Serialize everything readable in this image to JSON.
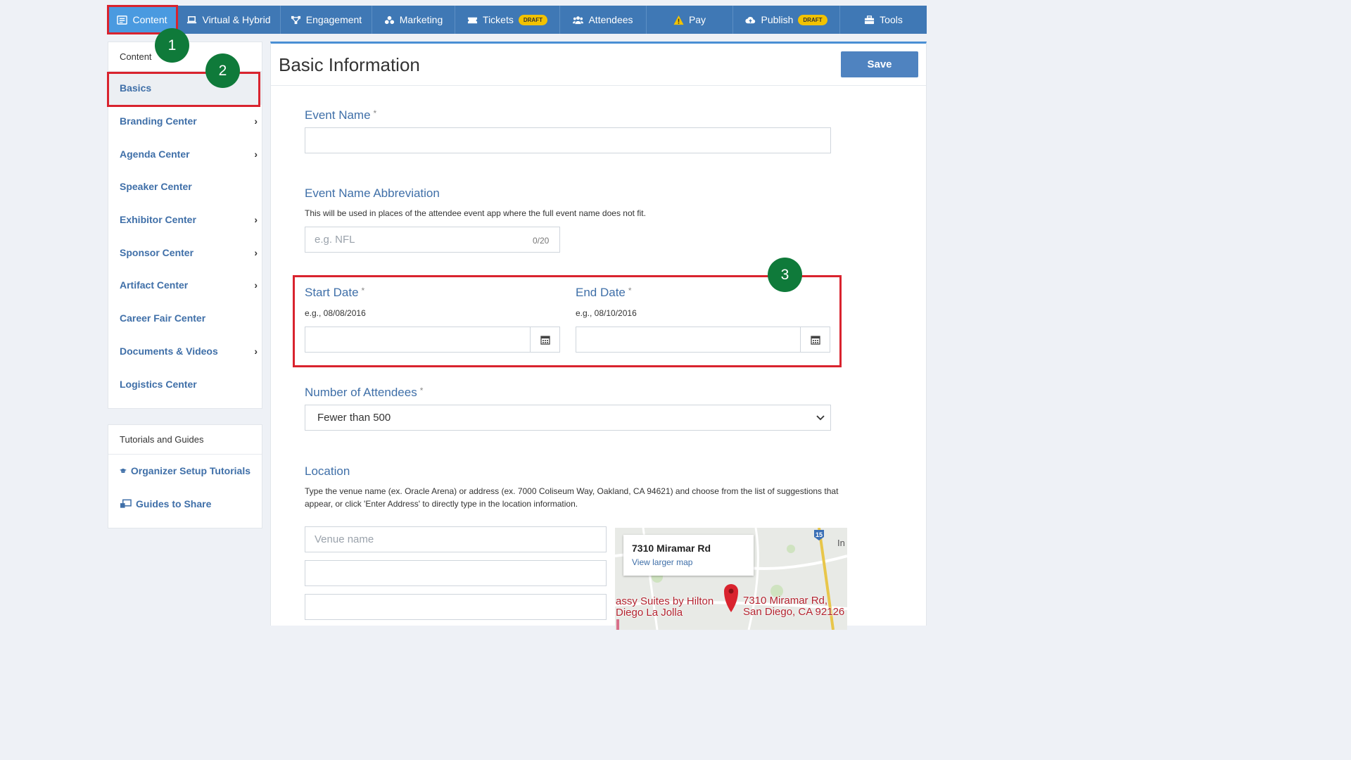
{
  "topnav": {
    "items": [
      {
        "label": "Content",
        "icon": "content-icon"
      },
      {
        "label": "Virtual & Hybrid",
        "icon": "laptop-icon"
      },
      {
        "label": "Engagement",
        "icon": "engagement-icon"
      },
      {
        "label": "Marketing",
        "icon": "marketing-icon"
      },
      {
        "label": "Tickets",
        "icon": "ticket-icon",
        "badge": "DRAFT"
      },
      {
        "label": "Attendees",
        "icon": "users-icon"
      },
      {
        "label": "Pay",
        "icon": "warning-icon"
      },
      {
        "label": "Publish",
        "icon": "cloud-upload-icon",
        "badge": "DRAFT"
      },
      {
        "label": "Tools",
        "icon": "toolbox-icon"
      }
    ],
    "active": "Content"
  },
  "sidebar": {
    "header": "Content",
    "items": [
      {
        "label": "Basics",
        "has_submenu": false
      },
      {
        "label": "Branding Center",
        "has_submenu": true
      },
      {
        "label": "Agenda Center",
        "has_submenu": true
      },
      {
        "label": "Speaker Center",
        "has_submenu": false
      },
      {
        "label": "Exhibitor Center",
        "has_submenu": true
      },
      {
        "label": "Sponsor Center",
        "has_submenu": true
      },
      {
        "label": "Artifact Center",
        "has_submenu": true
      },
      {
        "label": "Career Fair Center",
        "has_submenu": false
      },
      {
        "label": "Documents & Videos",
        "has_submenu": true
      },
      {
        "label": "Logistics Center",
        "has_submenu": false
      }
    ],
    "selected": "Basics",
    "chevron": "›"
  },
  "tutorials": {
    "header": "Tutorials and Guides",
    "items": [
      {
        "label": "Organizer Setup Tutorials",
        "icon": "graduation-cap-icon"
      },
      {
        "label": "Guides to Share",
        "icon": "share-screen-icon"
      }
    ]
  },
  "main": {
    "title": "Basic Information",
    "save_label": "Save",
    "required_mark": "*",
    "event_name": {
      "label": "Event Name",
      "value": ""
    },
    "abbreviation": {
      "label": "Event Name Abbreviation",
      "help": "This will be used in places of the attendee event app where the full event name does not fit.",
      "placeholder": "e.g. NFL",
      "counter": "0/20"
    },
    "start_date": {
      "label": "Start Date",
      "hint": "e.g., 08/08/2016",
      "value": ""
    },
    "end_date": {
      "label": "End Date",
      "hint": "e.g., 08/10/2016",
      "value": ""
    },
    "attendees": {
      "label": "Number of Attendees",
      "selected": "Fewer than 500"
    },
    "location": {
      "label": "Location",
      "help": "Type the venue name (ex. Oracle Arena) or address (ex. 7000 Coliseum Way, Oakland, CA 94621) and choose from the list of suggestions that appear, or click 'Enter Address' to directly type in the location information.",
      "venue_placeholder": "Venue name"
    },
    "map": {
      "card_title": "7310 Miramar Rd",
      "card_link": "View larger map",
      "hotel_line1": "assy Suites by Hilton",
      "hotel_line2": "Diego La Jolla",
      "pin_line1": "7310 Miramar Rd,",
      "pin_line2": "San Diego, CA 92126",
      "highway": "15",
      "edge_text": "In"
    }
  },
  "annotations": [
    "1",
    "2",
    "3"
  ],
  "colors": {
    "nav": "#3f78b5",
    "nav_active": "#4a9ae0",
    "accent": "#3f6fa8",
    "annotation_red": "#d9232e",
    "badge_green": "#0f7a3a",
    "draft_yellow": "#f2c200"
  }
}
